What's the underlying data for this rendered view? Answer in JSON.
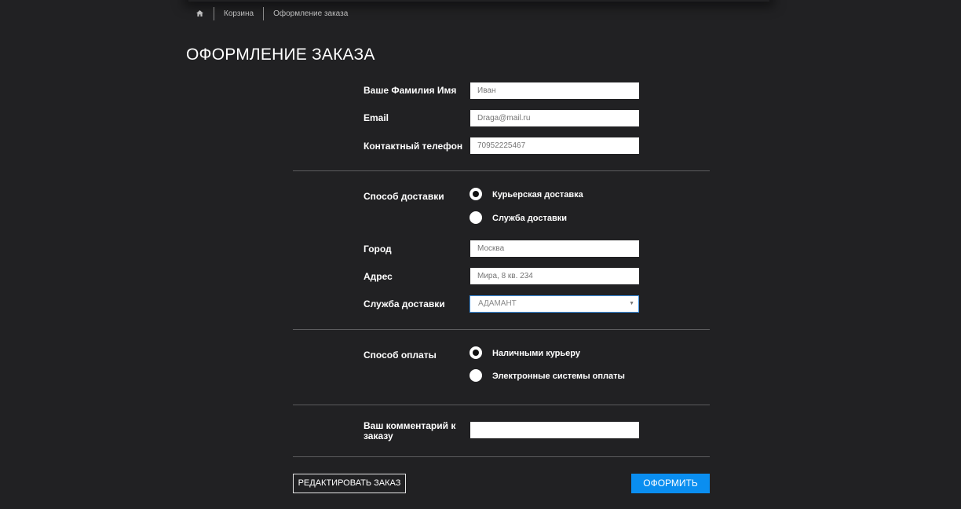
{
  "breadcrumb": {
    "home_icon": "home-icon",
    "items": [
      "Корзина",
      "Оформление заказа"
    ]
  },
  "page_title": "ОФОРМЛЕНИЕ ЗАКАЗА",
  "contact": {
    "name_label": "Ваше Фамилия Имя",
    "name_placeholder": "Иван",
    "email_label": "Email",
    "email_placeholder": "Draga@mail.ru",
    "phone_label": "Контактный телефон",
    "phone_placeholder": "70952225467"
  },
  "delivery": {
    "method_label": "Способ доставки",
    "options": [
      {
        "label": "Курьерская доставка",
        "checked": true
      },
      {
        "label": "Служба доставки",
        "checked": false
      }
    ],
    "city_label": "Город",
    "city_placeholder": "Москва",
    "address_label": "Адрес",
    "address_placeholder": "Мира, 8 кв. 234",
    "service_label": "Служба доставки",
    "service_selected": "АДАМАНТ"
  },
  "payment": {
    "method_label": "Способ оплаты",
    "options": [
      {
        "label": "Наличными курьеру",
        "checked": true
      },
      {
        "label": "Электронные системы оплаты",
        "checked": false
      }
    ]
  },
  "comment": {
    "label": "Ваш комментарий к заказу",
    "value": ""
  },
  "buttons": {
    "edit": "РЕДАКТИРОВАТЬ ЗАКАЗ",
    "submit": "ОФОРМИТЬ"
  },
  "colors": {
    "background": "#212123",
    "accent": "#0a8ef0",
    "divider": "#5c5c5e"
  }
}
